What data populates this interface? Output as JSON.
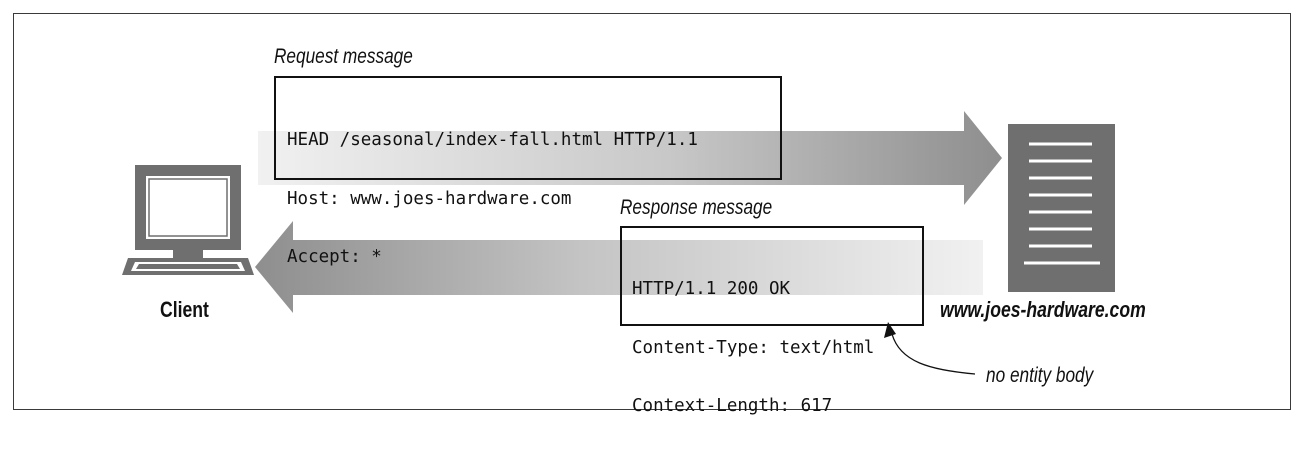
{
  "request": {
    "title": "Request message",
    "lines": [
      "HEAD /seasonal/index-fall.html HTTP/1.1",
      "Host: www.joes-hardware.com",
      "Accept: *"
    ]
  },
  "response": {
    "title": "Response message",
    "lines": [
      "HTTP/1.1 200 OK",
      "Content-Type: text/html",
      "Context-Length: 617"
    ]
  },
  "client": {
    "label": "Client",
    "icon": "computer-monitor-icon"
  },
  "server": {
    "label": "www.joes-hardware.com",
    "icon": "server-tower-icon"
  },
  "annotation": {
    "text": "no entity body"
  },
  "colors": {
    "arrow_dark": "#8c8c8c",
    "arrow_light": "#f0f0f0",
    "device": "#6f6f6f",
    "ink": "#111111"
  }
}
